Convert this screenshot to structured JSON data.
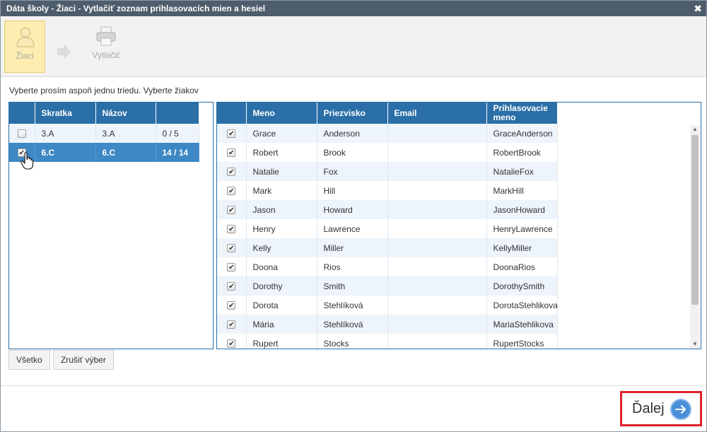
{
  "window": {
    "title": "Dáta školy - Žiaci - Vytlačiť zoznam prihlasovacích mien a hesiel"
  },
  "toolbar": {
    "steps": [
      {
        "label": "Žiaci",
        "icon": "user-icon"
      },
      {
        "label": "Vytlačiť",
        "icon": "printer-icon"
      }
    ]
  },
  "instruction": "Vyberte prosím aspoň jednu triedu. Vyberte žiakov",
  "classes": {
    "headers": [
      "Skratka",
      "Názov"
    ],
    "rows": [
      {
        "abbr": "3.A",
        "name": "3.A",
        "count": "0 / 5",
        "checked": false,
        "selected": false
      },
      {
        "abbr": "6.C",
        "name": "6.C",
        "count": "14 / 14",
        "checked": true,
        "selected": true
      }
    ]
  },
  "students": {
    "headers": [
      "Meno",
      "Priezvisko",
      "Email",
      "Prihlasovacie meno"
    ],
    "rows": [
      {
        "first": "Grace",
        "last": "Anderson",
        "email": "",
        "login": "GraceAnderson"
      },
      {
        "first": "Robert",
        "last": "Brook",
        "email": "",
        "login": "RobertBrook"
      },
      {
        "first": "Natalie",
        "last": "Fox",
        "email": "",
        "login": "NatalieFox"
      },
      {
        "first": "Mark",
        "last": "Hill",
        "email": "",
        "login": "MarkHill"
      },
      {
        "first": "Jason",
        "last": "Howard",
        "email": "",
        "login": "JasonHoward"
      },
      {
        "first": "Henry",
        "last": "Lawrence",
        "email": "",
        "login": "HenryLawrence"
      },
      {
        "first": "Kelly",
        "last": "Miller",
        "email": "",
        "login": "KellyMiller"
      },
      {
        "first": "Doona",
        "last": "Rios",
        "email": "",
        "login": "DoonaRios"
      },
      {
        "first": "Dorothy",
        "last": "Smith",
        "email": "",
        "login": "DorothySmith"
      },
      {
        "first": "Dorota",
        "last": "Stehlíková",
        "email": "",
        "login": "DorotaStehlikova"
      },
      {
        "first": "Mária",
        "last": "Stehlíková",
        "email": "",
        "login": "MariaStehlikova"
      },
      {
        "first": "Rupert",
        "last": "Stocks",
        "email": "",
        "login": "RupertStocks"
      }
    ]
  },
  "buttons": {
    "select_all": "Všetko",
    "clear": "Zrušiť výber",
    "next": "Ďalej"
  },
  "colors": {
    "header_blue": "#2a6fa7",
    "selected_row": "#3e88c5",
    "highlight_red": "#e0202c"
  }
}
